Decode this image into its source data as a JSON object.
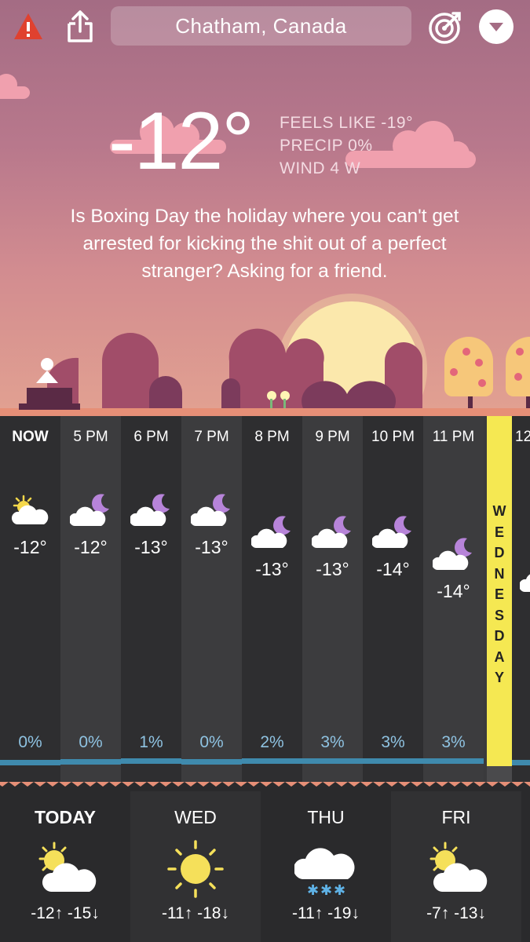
{
  "header": {
    "location": "Chatham, Canada",
    "alert_icon": "alert-triangle-icon",
    "share_icon": "share-icon",
    "radar_icon": "radar-icon",
    "menu_icon": "chevron-down-icon"
  },
  "current": {
    "temp": "-12°",
    "feels_like": "FEELS LIKE -19°",
    "precip": "PRECIP 0%",
    "wind": "WIND 4 W",
    "message": "Is Boxing Day the holiday where you can't get arrested for kicking the shit out of a perfect stranger? Asking for a friend."
  },
  "hourly": [
    {
      "label": "NOW",
      "temp": "-12°",
      "precip": "0%",
      "icon": "sun-cloud-icon"
    },
    {
      "label": "5 PM",
      "temp": "-12°",
      "precip": "0%",
      "icon": "moon-cloud-icon"
    },
    {
      "label": "6 PM",
      "temp": "-13°",
      "precip": "1%",
      "icon": "moon-cloud-icon"
    },
    {
      "label": "7 PM",
      "temp": "-13°",
      "precip": "0%",
      "icon": "moon-cloud-icon"
    },
    {
      "label": "8 PM",
      "temp": "-13°",
      "precip": "2%",
      "icon": "moon-cloud-icon"
    },
    {
      "label": "9 PM",
      "temp": "-13°",
      "precip": "3%",
      "icon": "moon-cloud-icon"
    },
    {
      "label": "10 PM",
      "temp": "-14°",
      "precip": "3%",
      "icon": "moon-cloud-icon"
    },
    {
      "label": "11 PM",
      "temp": "-14°",
      "precip": "3%",
      "icon": "moon-cloud-icon"
    },
    {
      "label": "12",
      "temp": "",
      "precip": "",
      "icon": "moon-cloud-icon"
    }
  ],
  "day_divider": "WEDNESDAY",
  "daily": [
    {
      "name": "TODAY",
      "range": "-12↑ -15↓",
      "icon": "sun-cloud-icon"
    },
    {
      "name": "WED",
      "range": "-11↑ -18↓",
      "icon": "sun-icon"
    },
    {
      "name": "THU",
      "range": "-11↑ -19↓",
      "icon": "snow-cloud-icon"
    },
    {
      "name": "FRI",
      "range": "-7↑ -13↓",
      "icon": "sun-cloud-icon"
    }
  ],
  "colors": {
    "sky_top": "#a46c84",
    "sky_bottom": "#e2a191",
    "accent_yellow": "#f5e852",
    "precip_blue": "#8fc3e2",
    "moon_purple": "#b784d9"
  }
}
